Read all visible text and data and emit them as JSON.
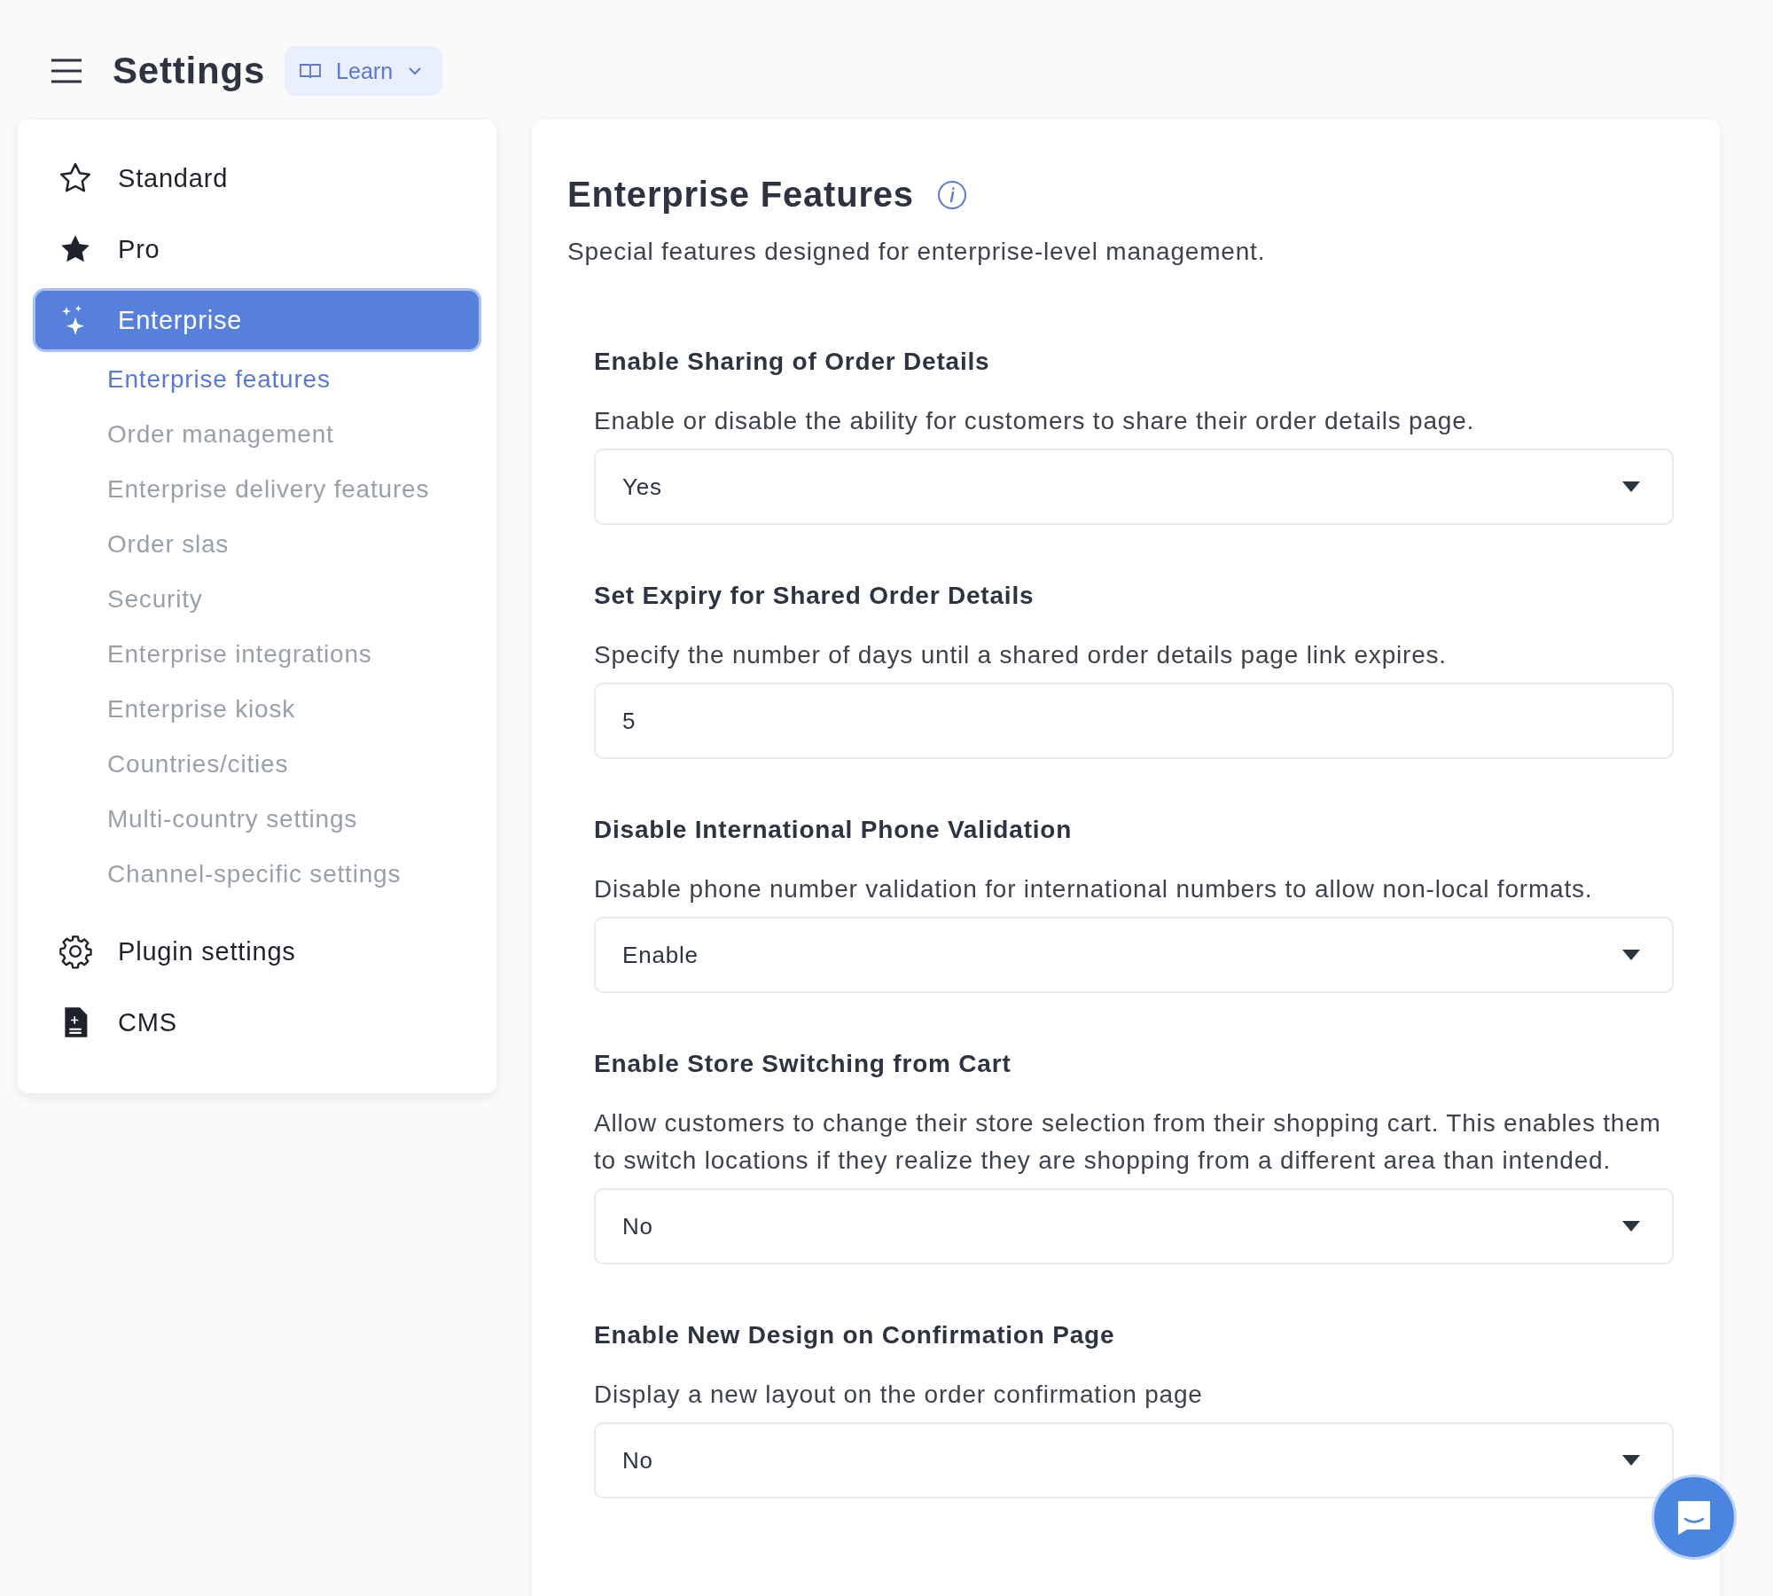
{
  "header": {
    "title": "Settings",
    "learn_button": "Learn"
  },
  "sidebar": {
    "items": [
      {
        "label": "Standard",
        "selected": false
      },
      {
        "label": "Pro",
        "selected": false
      },
      {
        "label": "Enterprise",
        "selected": true,
        "children": [
          {
            "label": "Enterprise features",
            "selected": true
          },
          {
            "label": "Order management",
            "selected": false
          },
          {
            "label": "Enterprise delivery features",
            "selected": false
          },
          {
            "label": "Order slas",
            "selected": false
          },
          {
            "label": "Security",
            "selected": false
          },
          {
            "label": "Enterprise integrations",
            "selected": false
          },
          {
            "label": "Enterprise kiosk",
            "selected": false
          },
          {
            "label": "Countries/cities",
            "selected": false
          },
          {
            "label": "Multi-country settings",
            "selected": false
          },
          {
            "label": "Channel-specific settings",
            "selected": false
          }
        ]
      },
      {
        "label": "Plugin settings",
        "selected": false
      },
      {
        "label": "CMS",
        "selected": false
      }
    ]
  },
  "main": {
    "title": "Enterprise Features",
    "subtitle": "Special features designed for enterprise-level management.",
    "settings": [
      {
        "kind": "select",
        "label": "Enable Sharing of Order Details",
        "description": "Enable or disable the ability for customers to share their order details page.",
        "value": "Yes"
      },
      {
        "kind": "input",
        "label": "Set Expiry for Shared Order Details",
        "description": "Specify the number of days until a shared order details page link expires.",
        "value": "5"
      },
      {
        "kind": "select",
        "label": "Disable International Phone Validation",
        "description": "Disable phone number validation for international numbers to allow non-local formats.",
        "value": "Enable"
      },
      {
        "kind": "select",
        "label": "Enable Store Switching from Cart",
        "description": "Allow customers to change their store selection from their shopping cart. This enables them to switch locations if they realize they are shopping from a different area than intended.",
        "value": "No"
      },
      {
        "kind": "select",
        "label": "Enable New Design on Confirmation Page",
        "description": "Display a new layout on the order confirmation page",
        "value": "No"
      }
    ]
  }
}
